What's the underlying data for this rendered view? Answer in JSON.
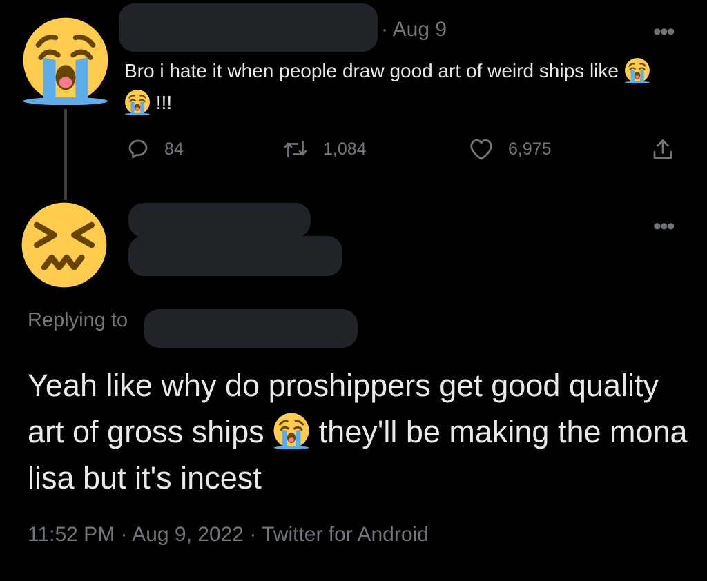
{
  "tweet1": {
    "date": "Aug 9",
    "text_before": "Bro i hate it when people draw good art of weird ships like",
    "text_after": " !!!",
    "inline_emoji": [
      "loudly-crying-face",
      "loudly-crying-face"
    ],
    "avatar_icon": "loudly-crying-face",
    "more_label": "•••",
    "stats": {
      "replies": "84",
      "retweets": "1,084",
      "likes": "6,975"
    }
  },
  "tweet2": {
    "avatar_icon": "confounded-face",
    "more_label": "•••",
    "replying_label": "Replying to",
    "text_before": "Yeah like why do proshippers get good quality art of gross ships",
    "text_after": " they'll be making the mona lisa but it's incest",
    "inline_emoji": [
      "loudly-crying-face"
    ],
    "footer": "11:52 PM · Aug 9, 2022 · Twitter for Android"
  },
  "colors": {
    "background": "#000000",
    "text": "#e7e9ea",
    "muted": "#71767b",
    "redaction": "#202327",
    "emoji_yellow": "#ffcc4d",
    "emoji_tear": "#5dadec"
  }
}
